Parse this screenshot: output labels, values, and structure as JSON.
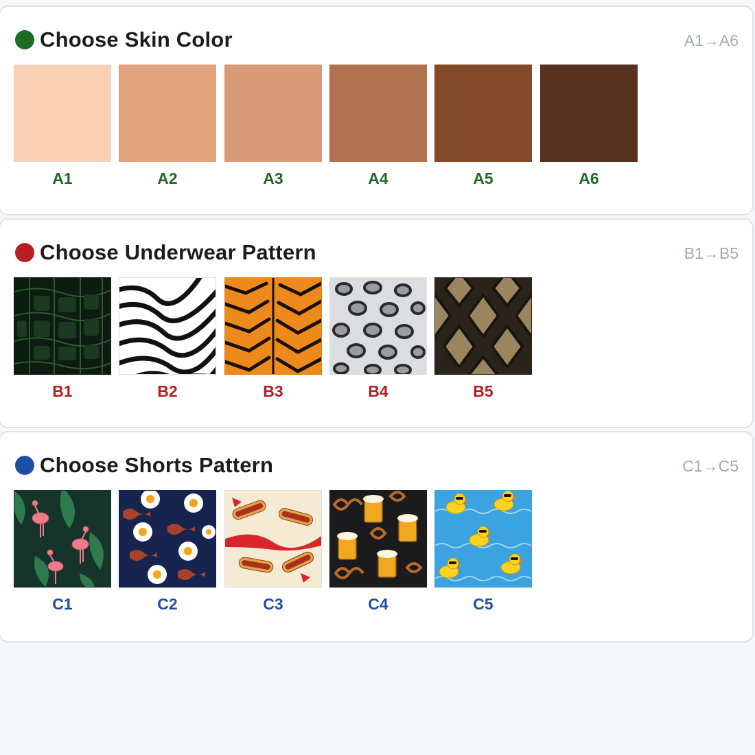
{
  "sections": [
    {
      "title": "Choose Skin Color",
      "range": "A1→A6",
      "accent": "#1e6b25",
      "items": [
        {
          "code": "A1",
          "color": "#fcd0b4"
        },
        {
          "code": "A2",
          "color": "#e2a27d"
        },
        {
          "code": "A3",
          "color": "#d99a78"
        },
        {
          "code": "A4",
          "color": "#b1724f"
        },
        {
          "code": "A5",
          "color": "#82492a"
        },
        {
          "code": "A6",
          "color": "#573220"
        }
      ]
    },
    {
      "title": "Choose Underwear Pattern",
      "range": "B1→B5",
      "accent": "#b81f22",
      "items": [
        {
          "code": "B1",
          "pattern": "crocodile-pattern"
        },
        {
          "code": "B2",
          "pattern": "zebra-pattern"
        },
        {
          "code": "B3",
          "pattern": "tiger-pattern"
        },
        {
          "code": "B4",
          "pattern": "snow-leopard-pattern"
        },
        {
          "code": "B5",
          "pattern": "python-pattern"
        }
      ]
    },
    {
      "title": "Choose Shorts Pattern",
      "range": "C1→C5",
      "accent": "#1f4fa3",
      "items": [
        {
          "code": "C1",
          "pattern": "flamingo-palm-pattern"
        },
        {
          "code": "C2",
          "pattern": "eggs-bacon-pattern"
        },
        {
          "code": "C3",
          "pattern": "hotdog-pattern"
        },
        {
          "code": "C4",
          "pattern": "beer-pretzel-pattern"
        },
        {
          "code": "C5",
          "pattern": "rubber-duck-pattern"
        }
      ]
    }
  ]
}
